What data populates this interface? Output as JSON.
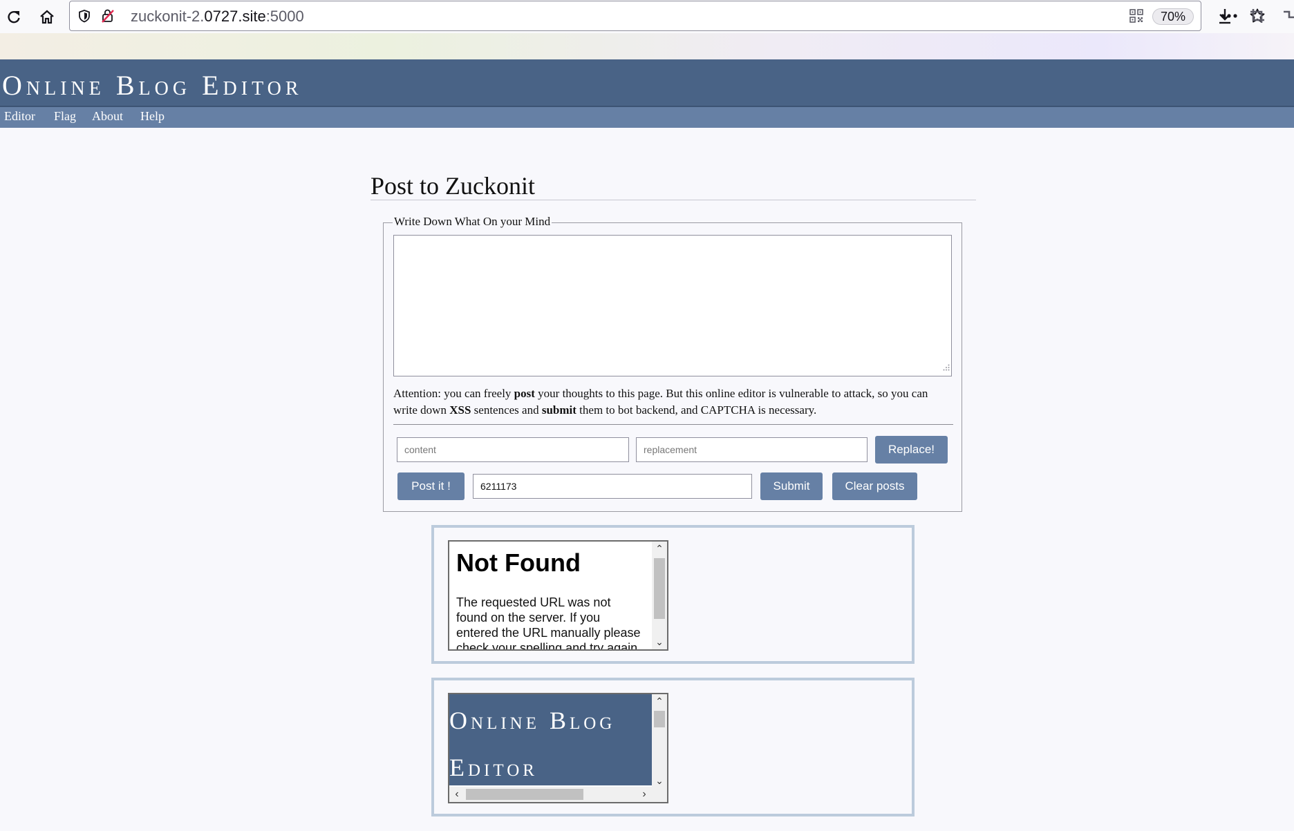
{
  "browser": {
    "url_prefix": "zuckonit-2.",
    "url_host": "0727.site",
    "url_port": ":5000",
    "zoom": "70%"
  },
  "site": {
    "title": "Online Blog Editor",
    "nav": [
      "Editor",
      "Flag",
      "About",
      "Help"
    ]
  },
  "main": {
    "heading": "Post to Zuckonit",
    "legend": "Write Down What On your Mind",
    "attention": {
      "p1": "Attention: you can freely ",
      "b1": "post",
      "p2": " your thoughts to this page. But this online editor is vulnerable to attack, so you can write down ",
      "b2": "XSS",
      "p3": " sentences and ",
      "b3": "submit",
      "p4": " them to bot backend, and CAPTCHA is necessary."
    },
    "content_placeholder": "content",
    "replacement_placeholder": "replacement",
    "replace_label": "Replace!",
    "post_label": "Post it !",
    "captcha_value": "6211173",
    "submit_label": "Submit",
    "clear_label": "Clear posts"
  },
  "posts": {
    "p1": {
      "title": "Not Found",
      "body": "The requested URL was not found on the server. If you entered the URL manually please check your spelling and try again."
    },
    "p2": {
      "title": "Online Blog Editor"
    }
  },
  "colors": {
    "header": "#496386",
    "nav": "#6680a5",
    "button": "#6680a5",
    "post_border": "#bccbdc"
  }
}
